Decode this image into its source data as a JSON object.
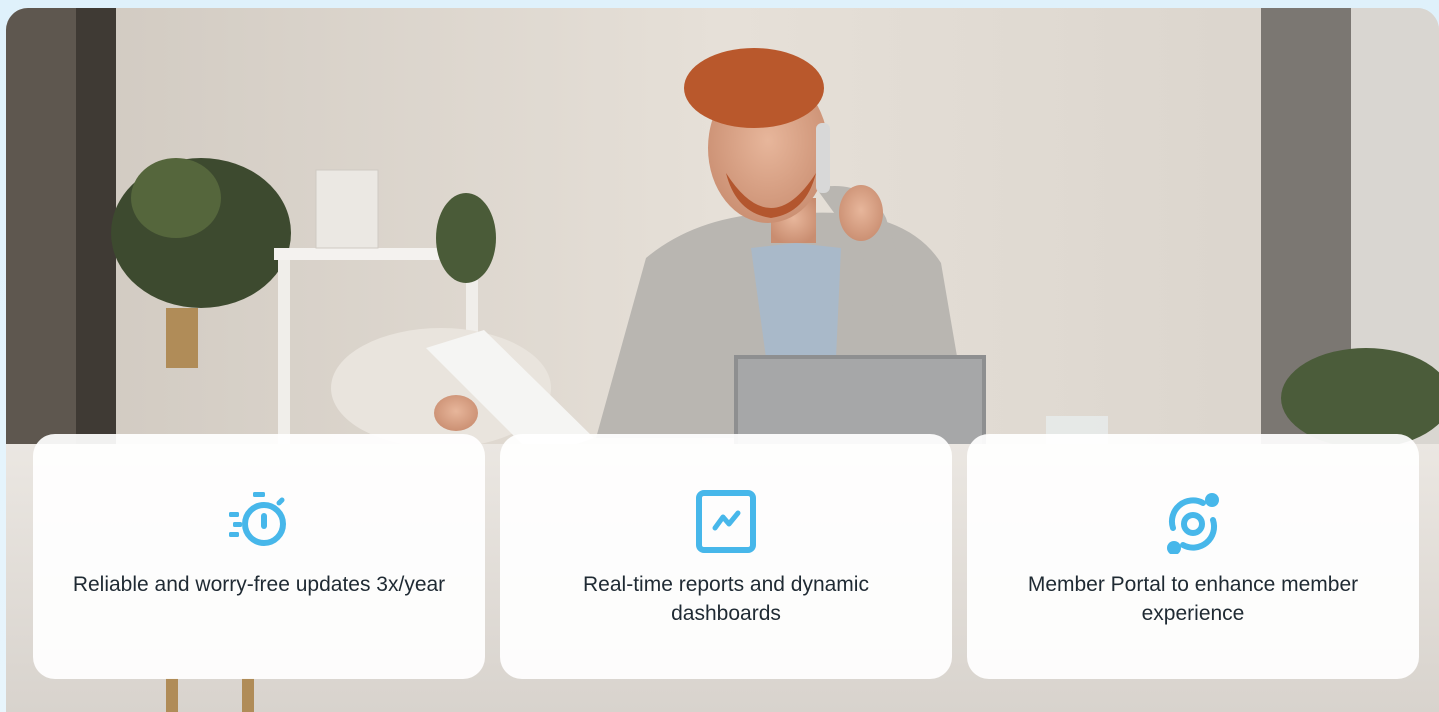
{
  "accent_color": "#47b7ea",
  "hero": {
    "image": "photo of smiling man on phone at desk with laptop and papers"
  },
  "features": [
    {
      "icon": "stopwatch-icon",
      "text": "Reliable and worry-free updates 3x/year"
    },
    {
      "icon": "chart-trend-icon",
      "text": "Real-time reports and dynamic dashboards"
    },
    {
      "icon": "portal-sync-icon",
      "text": "Member Portal to enhance member experience"
    }
  ]
}
